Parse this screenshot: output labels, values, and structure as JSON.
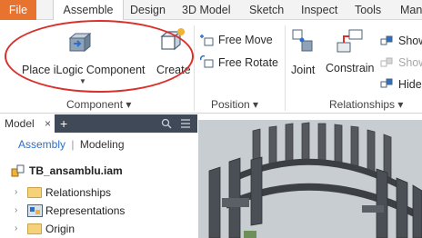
{
  "menu": {
    "file": "File",
    "tabs": [
      "Assemble",
      "Design",
      "3D Model",
      "Sketch",
      "Inspect",
      "Tools",
      "Man"
    ]
  },
  "ribbon": {
    "component": {
      "place_label": "Place iLogic Component",
      "create_label": "Create",
      "panel_title": "Component ▾"
    },
    "position": {
      "free_move": "Free Move",
      "free_rotate": "Free Rotate",
      "panel_title": "Position ▾"
    },
    "relationships": {
      "joint": "Joint",
      "constrain": "Constrain",
      "show": "Show",
      "show2": "Show",
      "hide": "Hide",
      "panel_title": "Relationships ▾"
    }
  },
  "model_panel": {
    "tab_label": "Model",
    "close": "×",
    "add": "+",
    "assembly_link": "Assembly",
    "modeling_link": "Modeling",
    "root": "TB_ansamblu.iam",
    "items": [
      "Relationships",
      "Representations",
      "Origin"
    ]
  },
  "colors": {
    "file_tab": "#e8732f",
    "panel_header": "#3f4957",
    "annotation_circle": "#d9302b",
    "viewport_bg": "#c8cdd2",
    "part_color": "#4a4f55"
  },
  "icons": [
    "place-component-icon",
    "create-component-icon",
    "free-move-icon",
    "free-rotate-icon",
    "joint-icon",
    "constrain-icon",
    "show-icon",
    "hide-icon",
    "search-icon",
    "menu-icon"
  ]
}
